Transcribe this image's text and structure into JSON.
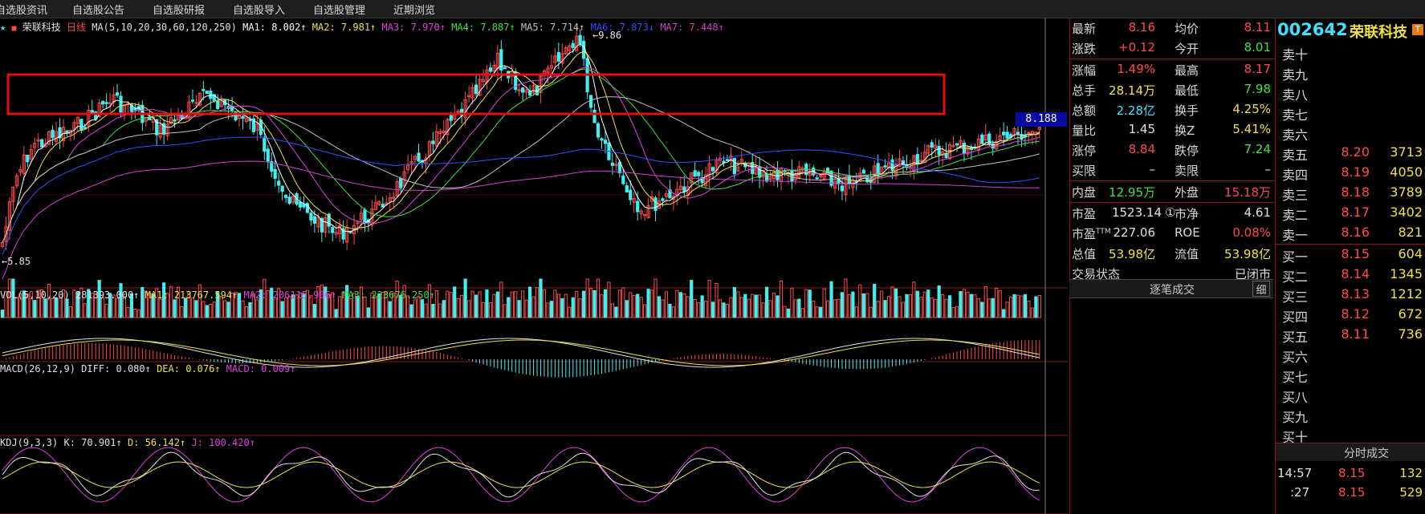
{
  "nav": {
    "tabs": [
      "自选股资讯",
      "自选股公告",
      "自选股研报",
      "自选股导入",
      "自选股管理",
      "近期浏览"
    ]
  },
  "stock": {
    "name": "荣联科技",
    "code": "002642",
    "period": "日线"
  },
  "colors": {
    "up": "#ff4a4a",
    "down": "#40f0f0",
    "frame": "#cc1010"
  },
  "ma_line": {
    "prefix": "MA(5,10,20,30,60,120,250)",
    "items": [
      {
        "label": "MA1: 8.002↑",
        "color": "#ffffff"
      },
      {
        "label": "MA2: 7.981↑",
        "color": "#f0e040"
      },
      {
        "label": "MA3: 7.970↑",
        "color": "#e040e0"
      },
      {
        "label": "MA4: 7.887↑",
        "color": "#40e040"
      },
      {
        "label": "MA5: 7.714↑",
        "color": "#c0c0c0"
      },
      {
        "label": "MA6: 7.873↓",
        "color": "#3050ff"
      },
      {
        "label": "MA7: 7.448↑",
        "color": "#d040d0"
      }
    ]
  },
  "annotations": {
    "high": "9.86",
    "low": "5.85",
    "current": "8.188"
  },
  "vol_line": {
    "prefix": "VOL(5,10,20)",
    "value": "281393.000↑",
    "items": [
      {
        "label": "MA1: 213767.594↑",
        "color": "#f0e040"
      },
      {
        "label": "MA2: 206115.906↑",
        "color": "#e040e0"
      },
      {
        "label": "MA3: 223676.250↑",
        "color": "#40e040"
      }
    ]
  },
  "macd_line": {
    "prefix": "MACD(26,12,9)",
    "items": [
      {
        "label": "DIFF: 0.080↑",
        "color": "#e0e0e0"
      },
      {
        "label": "DEA: 0.076↑",
        "color": "#f0e040"
      },
      {
        "label": "MACD: 0.009↑",
        "color": "#e040e0"
      }
    ]
  },
  "kdj_line": {
    "prefix": "KDJ(9,3,3)",
    "items": [
      {
        "label": "K: 70.901↑",
        "color": "#e0e0e0"
      },
      {
        "label": "D: 56.142↑",
        "color": "#f0e040"
      },
      {
        "label": "J: 100.420↑",
        "color": "#e040e0"
      }
    ]
  },
  "quote": {
    "rows": [
      {
        "l1": "最新",
        "v1": "8.16",
        "c1": "#ff4a4a",
        "l2": "均价",
        "v2": "8.11",
        "c2": "#ff4a4a"
      },
      {
        "l1": "涨跌",
        "v1": "+0.12",
        "c1": "#ff4a4a",
        "l2": "今开",
        "v2": "8.01",
        "c2": "#44e044"
      },
      {
        "l1": "涨幅",
        "v1": "1.49%",
        "c1": "#ff4a4a",
        "l2": "最高",
        "v2": "8.17",
        "c2": "#ff4a4a"
      },
      {
        "l1": "总手",
        "v1": "28.14万",
        "c1": "#f0e04a",
        "l2": "最低",
        "v2": "7.98",
        "c2": "#44e044"
      },
      {
        "l1": "总额",
        "v1": "2.28亿",
        "c1": "#40e0ff",
        "l2": "换手",
        "v2": "4.25%",
        "c2": "#f0e04a"
      },
      {
        "l1": "量比",
        "v1": "1.45",
        "c1": "#e0e0e0",
        "l2": "换Z",
        "v2": "5.41%",
        "c2": "#f0e04a"
      },
      {
        "l1": "涨停",
        "v1": "8.84",
        "c1": "#ff4a4a",
        "l2": "跌停",
        "v2": "7.24",
        "c2": "#44e044"
      },
      {
        "l1": "买限",
        "v1": "–",
        "c1": "#e0e0e0",
        "l2": "卖限",
        "v2": "–",
        "c2": "#e0e0e0"
      },
      {
        "l1": "内盘",
        "v1": "12.95万",
        "c1": "#44e044",
        "l2": "外盘",
        "v2": "15.18万",
        "c2": "#ff4a4a"
      },
      {
        "l1": "市盈",
        "v1": "1523.14",
        "c1": "#e0e0e0",
        "l2": "市净",
        "v2": "4.61",
        "c2": "#e0e0e0"
      },
      {
        "l1": "市盈TTM",
        "v1": "227.06",
        "c1": "#e0e0e0",
        "l2": "ROE",
        "v2": "0.08%",
        "c2": "#ff4a4a"
      },
      {
        "l1": "总值",
        "v1": "53.98亿",
        "c1": "#f0e04a",
        "l2": "流值",
        "v2": "53.98亿",
        "c2": "#f0e04a"
      },
      {
        "l1": "交易状态",
        "v1": "",
        "c1": "#e0e0e0",
        "l2": "",
        "v2": "已闭市",
        "c2": "#e0e0e0"
      }
    ],
    "info_icon": "①",
    "trades_label": "逐笔成交",
    "detail_label": "细"
  },
  "book": {
    "sell": [
      {
        "label": "卖十",
        "price": "",
        "vol": ""
      },
      {
        "label": "卖九",
        "price": "",
        "vol": ""
      },
      {
        "label": "卖八",
        "price": "",
        "vol": ""
      },
      {
        "label": "卖七",
        "price": "",
        "vol": ""
      },
      {
        "label": "卖六",
        "price": "",
        "vol": ""
      },
      {
        "label": "卖五",
        "price": "8.20",
        "vol": "3713"
      },
      {
        "label": "卖四",
        "price": "8.19",
        "vol": "4050"
      },
      {
        "label": "卖三",
        "price": "8.18",
        "vol": "3789"
      },
      {
        "label": "卖二",
        "price": "8.17",
        "vol": "3402"
      },
      {
        "label": "卖一",
        "price": "8.16",
        "vol": "821"
      }
    ],
    "buy": [
      {
        "label": "买一",
        "price": "8.15",
        "vol": "604"
      },
      {
        "label": "买二",
        "price": "8.14",
        "vol": "1345"
      },
      {
        "label": "买三",
        "price": "8.13",
        "vol": "1212"
      },
      {
        "label": "买四",
        "price": "8.12",
        "vol": "672"
      },
      {
        "label": "买五",
        "price": "8.11",
        "vol": "736"
      },
      {
        "label": "买六",
        "price": "",
        "vol": ""
      },
      {
        "label": "买七",
        "price": "",
        "vol": ""
      },
      {
        "label": "买八",
        "price": "",
        "vol": ""
      },
      {
        "label": "买九",
        "price": "",
        "vol": ""
      },
      {
        "label": "买十",
        "price": "",
        "vol": ""
      }
    ],
    "ticks_label": "分时成交",
    "ticks": [
      {
        "time": "14:57",
        "price": "8.15",
        "vol": "132"
      },
      {
        "time": ":27",
        "price": "8.15",
        "vol": "529"
      }
    ]
  }
}
